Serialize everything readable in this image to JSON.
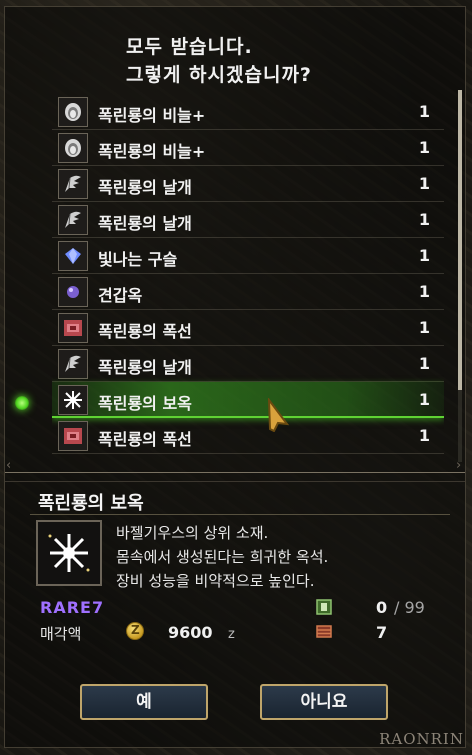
{
  "dialog": {
    "prompt_line1": "모두 받습니다.",
    "prompt_line2": "그렇게 하시겠습니까?"
  },
  "items": [
    {
      "name": "폭린룡의 비늘+",
      "qty": "1",
      "icon": "scale-icon"
    },
    {
      "name": "폭린룡의 비늘+",
      "qty": "1",
      "icon": "scale-icon"
    },
    {
      "name": "폭린룡의 날개",
      "qty": "1",
      "icon": "wing-icon"
    },
    {
      "name": "폭린룡의 날개",
      "qty": "1",
      "icon": "wing-icon"
    },
    {
      "name": "빛나는 구슬",
      "qty": "1",
      "icon": "gem-icon"
    },
    {
      "name": "견갑옥",
      "qty": "1",
      "icon": "orb-icon"
    },
    {
      "name": "폭린룡의 폭선",
      "qty": "1",
      "icon": "gland-icon"
    },
    {
      "name": "폭린룡의 날개",
      "qty": "1",
      "icon": "wing-icon"
    },
    {
      "name": "폭린룡의 보옥",
      "qty": "1",
      "icon": "jewel-icon",
      "selected": true
    },
    {
      "name": "폭린룡의 폭선",
      "qty": "1",
      "icon": "gland-icon"
    }
  ],
  "detail": {
    "title": "폭린룡의 보옥",
    "desc1": "바젤기우스의 상위 소재.",
    "desc2": "몸속에서 생성된다는 희귀한 옥석.",
    "desc3": "장비 성능을 비약적으로 높인다.",
    "rarity": "RARE7",
    "sell_label": "매각액",
    "sell_value": "9600",
    "sell_unit": "z",
    "owned_count": "0",
    "owned_max": "/ 99",
    "box_count": "7"
  },
  "buttons": {
    "yes": "예",
    "no": "아니요"
  },
  "watermark": "RAONRIN",
  "colors": {
    "selection": "#4fd41f",
    "rarity": "#9f70ff",
    "button_border": "#bfa56a"
  }
}
